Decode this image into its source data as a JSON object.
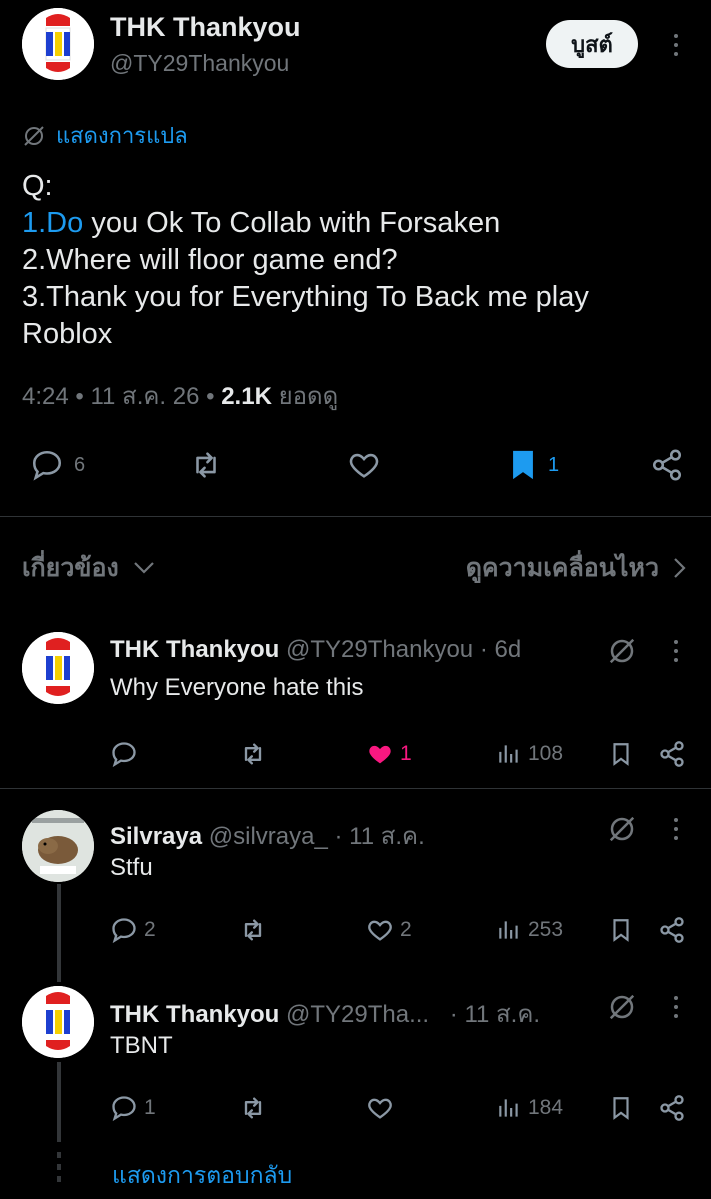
{
  "tweet": {
    "author_name": "THK Thankyou",
    "author_handle": "@TY29Thankyou",
    "boost_label": "บูสต์",
    "translate_label": "แสดงการแปล",
    "body_q": "Q:",
    "body_link": "1.Do",
    "body_line1_rest": " you Ok To Collab with Forsaken",
    "body_line2": "2.Where will floor game end?",
    "body_line3": "3.Thank you for Everything To Back me play Roblox",
    "time": "4:24",
    "date": "11 ส.ค. 26",
    "views_count": "2.1K",
    "views_label": "ยอดดู",
    "reply_count": "6",
    "bookmark_count": "1"
  },
  "section": {
    "related_label": "เกี่ยวข้อง",
    "motion_label": "ดูความเคลื่อนไหว"
  },
  "replies": [
    {
      "name": "THK Thankyou",
      "handle": "@TY29Thankyou",
      "meta": "· 6d",
      "text": "Why Everyone hate this",
      "reply_count": "",
      "like_count": "1",
      "views": "108"
    },
    {
      "name": "Silvraya",
      "handle": "@silvraya_",
      "meta": "· 11 ส.ค.",
      "text": "Stfu",
      "reply_count": "2",
      "like_count": "2",
      "views": "253"
    },
    {
      "name": "THK Thankyou",
      "handle": "@TY29Tha...",
      "meta": "· 11 ส.ค.",
      "text": "TBNT",
      "reply_count": "1",
      "like_count": "",
      "views": "184"
    }
  ],
  "show_replies_label": "แสดงการตอบกลับ",
  "colors": {
    "background": "#000000",
    "accent": "#1d9bf0",
    "muted": "#71767b",
    "like": "#f91880"
  }
}
